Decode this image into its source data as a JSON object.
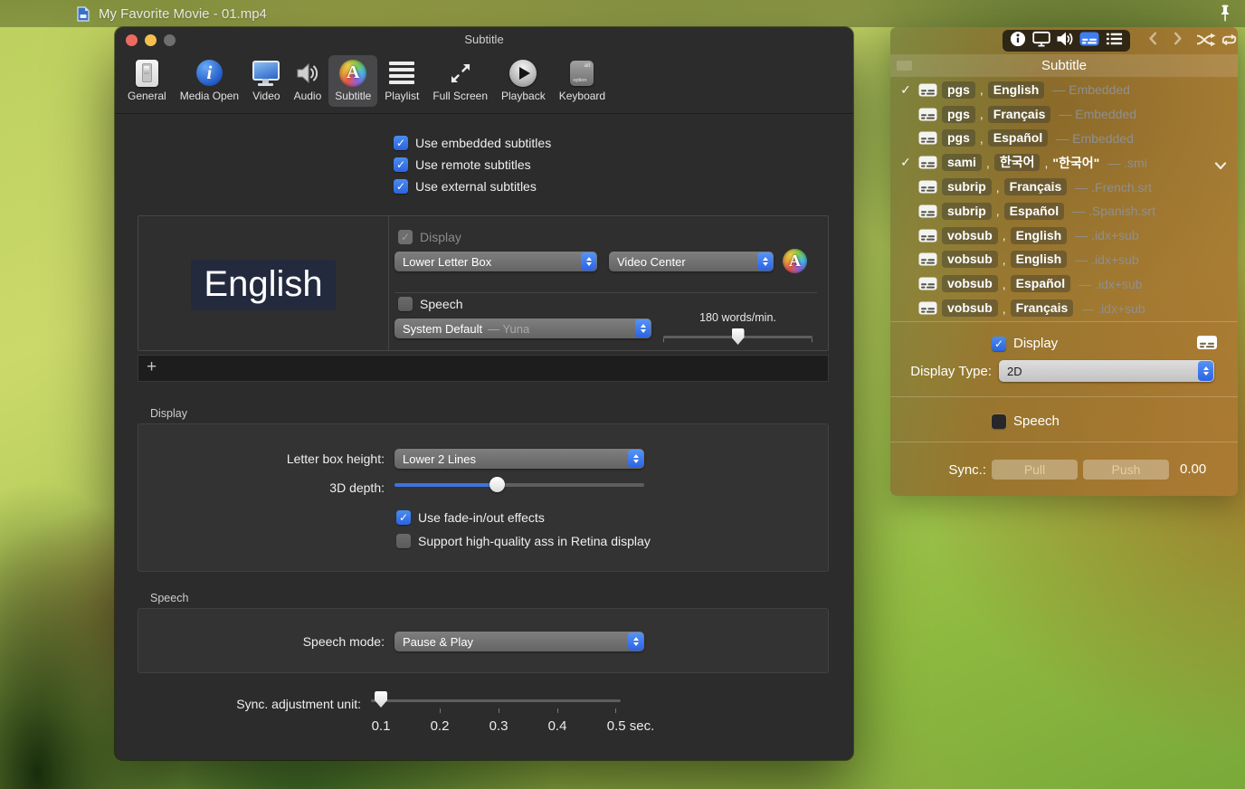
{
  "colors": {
    "accent_blue": "#2f6fe4",
    "traffic_close": "#ee6a5f",
    "traffic_minimize": "#f5bf4f",
    "traffic_zoom_disabled": "#6f6f6f",
    "window_bg": "#2c2c2c",
    "panel_tint": "#a4742f"
  },
  "icons": {
    "check": "✓",
    "plus": "+"
  },
  "window_titlebar": {
    "title": "My Favorite Movie - 01.mp4"
  },
  "prefs": {
    "title": "Subtitle",
    "toolbar": {
      "items": [
        {
          "label": "General"
        },
        {
          "label": "Media Open"
        },
        {
          "label": "Video"
        },
        {
          "label": "Audio"
        },
        {
          "label": "Subtitle",
          "selected": true
        },
        {
          "label": "Playlist"
        },
        {
          "label": "Full Screen"
        },
        {
          "label": "Playback"
        },
        {
          "label": "Keyboard"
        }
      ]
    },
    "source_checkboxes": [
      {
        "label": "Use embedded subtitles",
        "checked": true
      },
      {
        "label": "Use remote subtitles",
        "checked": true
      },
      {
        "label": "Use external subtitles",
        "checked": true
      }
    ],
    "preview": {
      "sample_text": "English",
      "display_checkbox": {
        "label": "Display",
        "checked": true,
        "disabled": true
      },
      "position_select": {
        "value": "Lower Letter Box"
      },
      "align_select": {
        "value": "Video Center"
      },
      "speech_checkbox": {
        "label": "Speech",
        "checked": false
      },
      "voice_select": {
        "value": "System Default",
        "detail": "— Yuna"
      },
      "rate_label": "180 words/min.",
      "rate_percent": 50
    },
    "display_section": {
      "title": "Display",
      "letterbox_label": "Letter box height:",
      "letterbox_select": {
        "value": "Lower 2 Lines"
      },
      "depth_label": "3D depth:",
      "depth_percent": 41,
      "fade_checkbox": {
        "label": "Use fade-in/out effects",
        "checked": true
      },
      "ass_checkbox": {
        "label": "Support high-quality ass in Retina display",
        "checked": false
      }
    },
    "speech_section": {
      "title": "Speech",
      "mode_label": "Speech mode:",
      "mode_select": {
        "value": "Pause & Play"
      }
    },
    "sync_unit": {
      "label": "Sync. adjustment unit:",
      "selected_value": "0.1",
      "ticks": [
        "0.1",
        "0.2",
        "0.3",
        "0.4",
        "0.5 sec."
      ]
    }
  },
  "panel": {
    "header": "Subtitle",
    "separator": ",",
    "tracks": [
      {
        "checked": true,
        "codec": "pgs",
        "lang": "English",
        "suffix": "— Embedded"
      },
      {
        "checked": false,
        "codec": "pgs",
        "lang": "Français",
        "suffix": "— Embedded"
      },
      {
        "checked": false,
        "codec": "pgs",
        "lang": "Español",
        "suffix": "— Embedded"
      },
      {
        "checked": true,
        "codec": "sami",
        "lang": "한국어",
        "name": "\"한국어\"",
        "suffix": "— .smi",
        "expandable": true
      },
      {
        "checked": false,
        "codec": "subrip",
        "lang": "Français",
        "suffix": "— .French.srt"
      },
      {
        "checked": false,
        "codec": "subrip",
        "lang": "Español",
        "suffix": "— .Spanish.srt"
      },
      {
        "checked": false,
        "codec": "vobsub",
        "lang": "English",
        "suffix": "— .idx+sub"
      },
      {
        "checked": false,
        "codec": "vobsub",
        "lang": "English",
        "suffix": "— .idx+sub"
      },
      {
        "checked": false,
        "codec": "vobsub",
        "lang": "Español",
        "suffix": "— .idx+sub"
      },
      {
        "checked": false,
        "codec": "vobsub",
        "lang": "Français",
        "suffix": "— .idx+sub"
      }
    ],
    "display_checkbox": {
      "label": "Display",
      "checked": true
    },
    "display_type_label": "Display Type:",
    "display_type_select": {
      "value": "2D"
    },
    "speech_checkbox": {
      "label": "Speech",
      "checked": false
    },
    "sync_label": "Sync.:",
    "pull_button": "Pull",
    "push_button": "Push",
    "sync_value": "0.00"
  }
}
